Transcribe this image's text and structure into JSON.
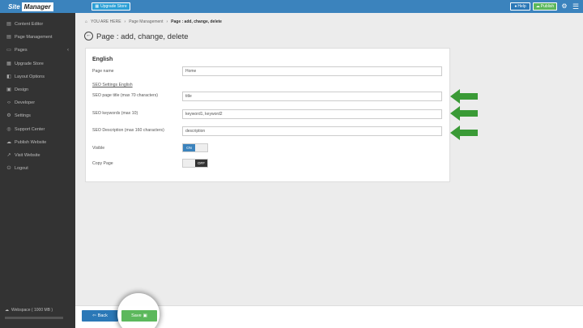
{
  "header": {
    "logo_part1": "Site",
    "logo_part2": "Manager",
    "upgrade_label": "Upgrade Store",
    "help_label": "Help",
    "publish_label": "Publish",
    "brand_color": "#3b83bd"
  },
  "sidebar": {
    "items": [
      {
        "label": "Content Editor",
        "icon": "file-icon"
      },
      {
        "label": "Page Management",
        "icon": "file-icon"
      },
      {
        "label": "Pages",
        "icon": "folder-icon"
      },
      {
        "label": "Upgrade Store",
        "icon": "store-icon"
      },
      {
        "label": "Layout Options",
        "icon": "layout-icon"
      },
      {
        "label": "Design",
        "icon": "image-icon"
      },
      {
        "label": "Developer",
        "icon": "code-icon"
      },
      {
        "label": "Settings",
        "icon": "gear-icon"
      },
      {
        "label": "Support Center",
        "icon": "lifebuoy-icon"
      },
      {
        "label": "Publish Website",
        "icon": "cloud-icon"
      },
      {
        "label": "Visit Website",
        "icon": "external-link-icon"
      },
      {
        "label": "Logout",
        "icon": "power-icon"
      }
    ],
    "webspace_label": "Webspace ( 1000 MB )",
    "webspace_percent": "0%",
    "webspace_usage_fraction": 0
  },
  "breadcrumb": {
    "you_are_here": "YOU ARE HERE",
    "page_management": "Page Management",
    "current": "Page : add, change, delete"
  },
  "page": {
    "title": "Page : add, change, delete"
  },
  "form": {
    "section_title": "English",
    "page_name_label": "Page name",
    "page_name_value": "Home",
    "seo_settings_link": "SEO Settings English",
    "seo_title_label": "SEO page title (max 70 characters)",
    "seo_title_value": "title",
    "seo_keywords_label": "SEO keywords (max 10)",
    "seo_keywords_value": "keyword1, keyword2",
    "seo_description_label": "SEO Description (max 160 characters)",
    "seo_description_value": "description",
    "visible_label": "Visible",
    "visible_toggle_text": "ON",
    "copy_page_label": "Copy Page",
    "copy_page_toggle_text": "OFF"
  },
  "footer": {
    "back_label": "Back",
    "save_label": "Save"
  },
  "annotations": {
    "arrow_color": "#3a9a36"
  }
}
